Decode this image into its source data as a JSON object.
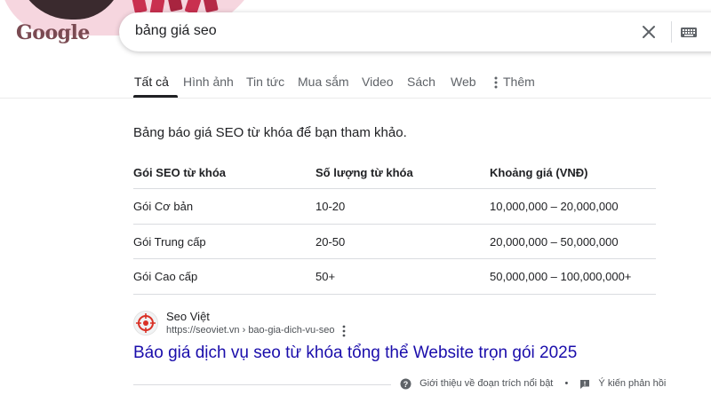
{
  "logo": {
    "text": "Google"
  },
  "search": {
    "query": "bảng giá seo"
  },
  "tabs": [
    {
      "label": "Tất cả"
    },
    {
      "label": "Hình ảnh"
    },
    {
      "label": "Tin tức"
    },
    {
      "label": "Mua sắm"
    },
    {
      "label": "Video"
    },
    {
      "label": "Sách"
    },
    {
      "label": "Web"
    },
    {
      "label": "Thêm"
    }
  ],
  "snippet": {
    "intro": "Bảng báo giá SEO từ khóa để bạn tham khảo.",
    "headers": [
      "Gói SEO từ khóa",
      "Số lượng từ khóa",
      "Khoảng giá (VNĐ)"
    ],
    "rows": [
      [
        "Gói Cơ bản",
        "10-20",
        "10,000,000 – 20,000,000"
      ],
      [
        "Gói Trung cấp",
        "20-50",
        "20,000,000 – 50,000,000"
      ],
      [
        "Gói Cao cấp",
        "50+",
        "50,000,000 – 100,000,000+"
      ]
    ]
  },
  "source": {
    "site_name": "Seo Việt",
    "url": "https://seoviet.vn › bao-gia-dich-vu-seo",
    "title": "Báo giá dịch vụ seo từ khóa tổng thể Website trọn gói 2025"
  },
  "footer": {
    "about_label": "Giới thiệu về đoạn trích nổi bật",
    "separator": "•",
    "feedback_label": "Ý kiến phản hồi"
  }
}
